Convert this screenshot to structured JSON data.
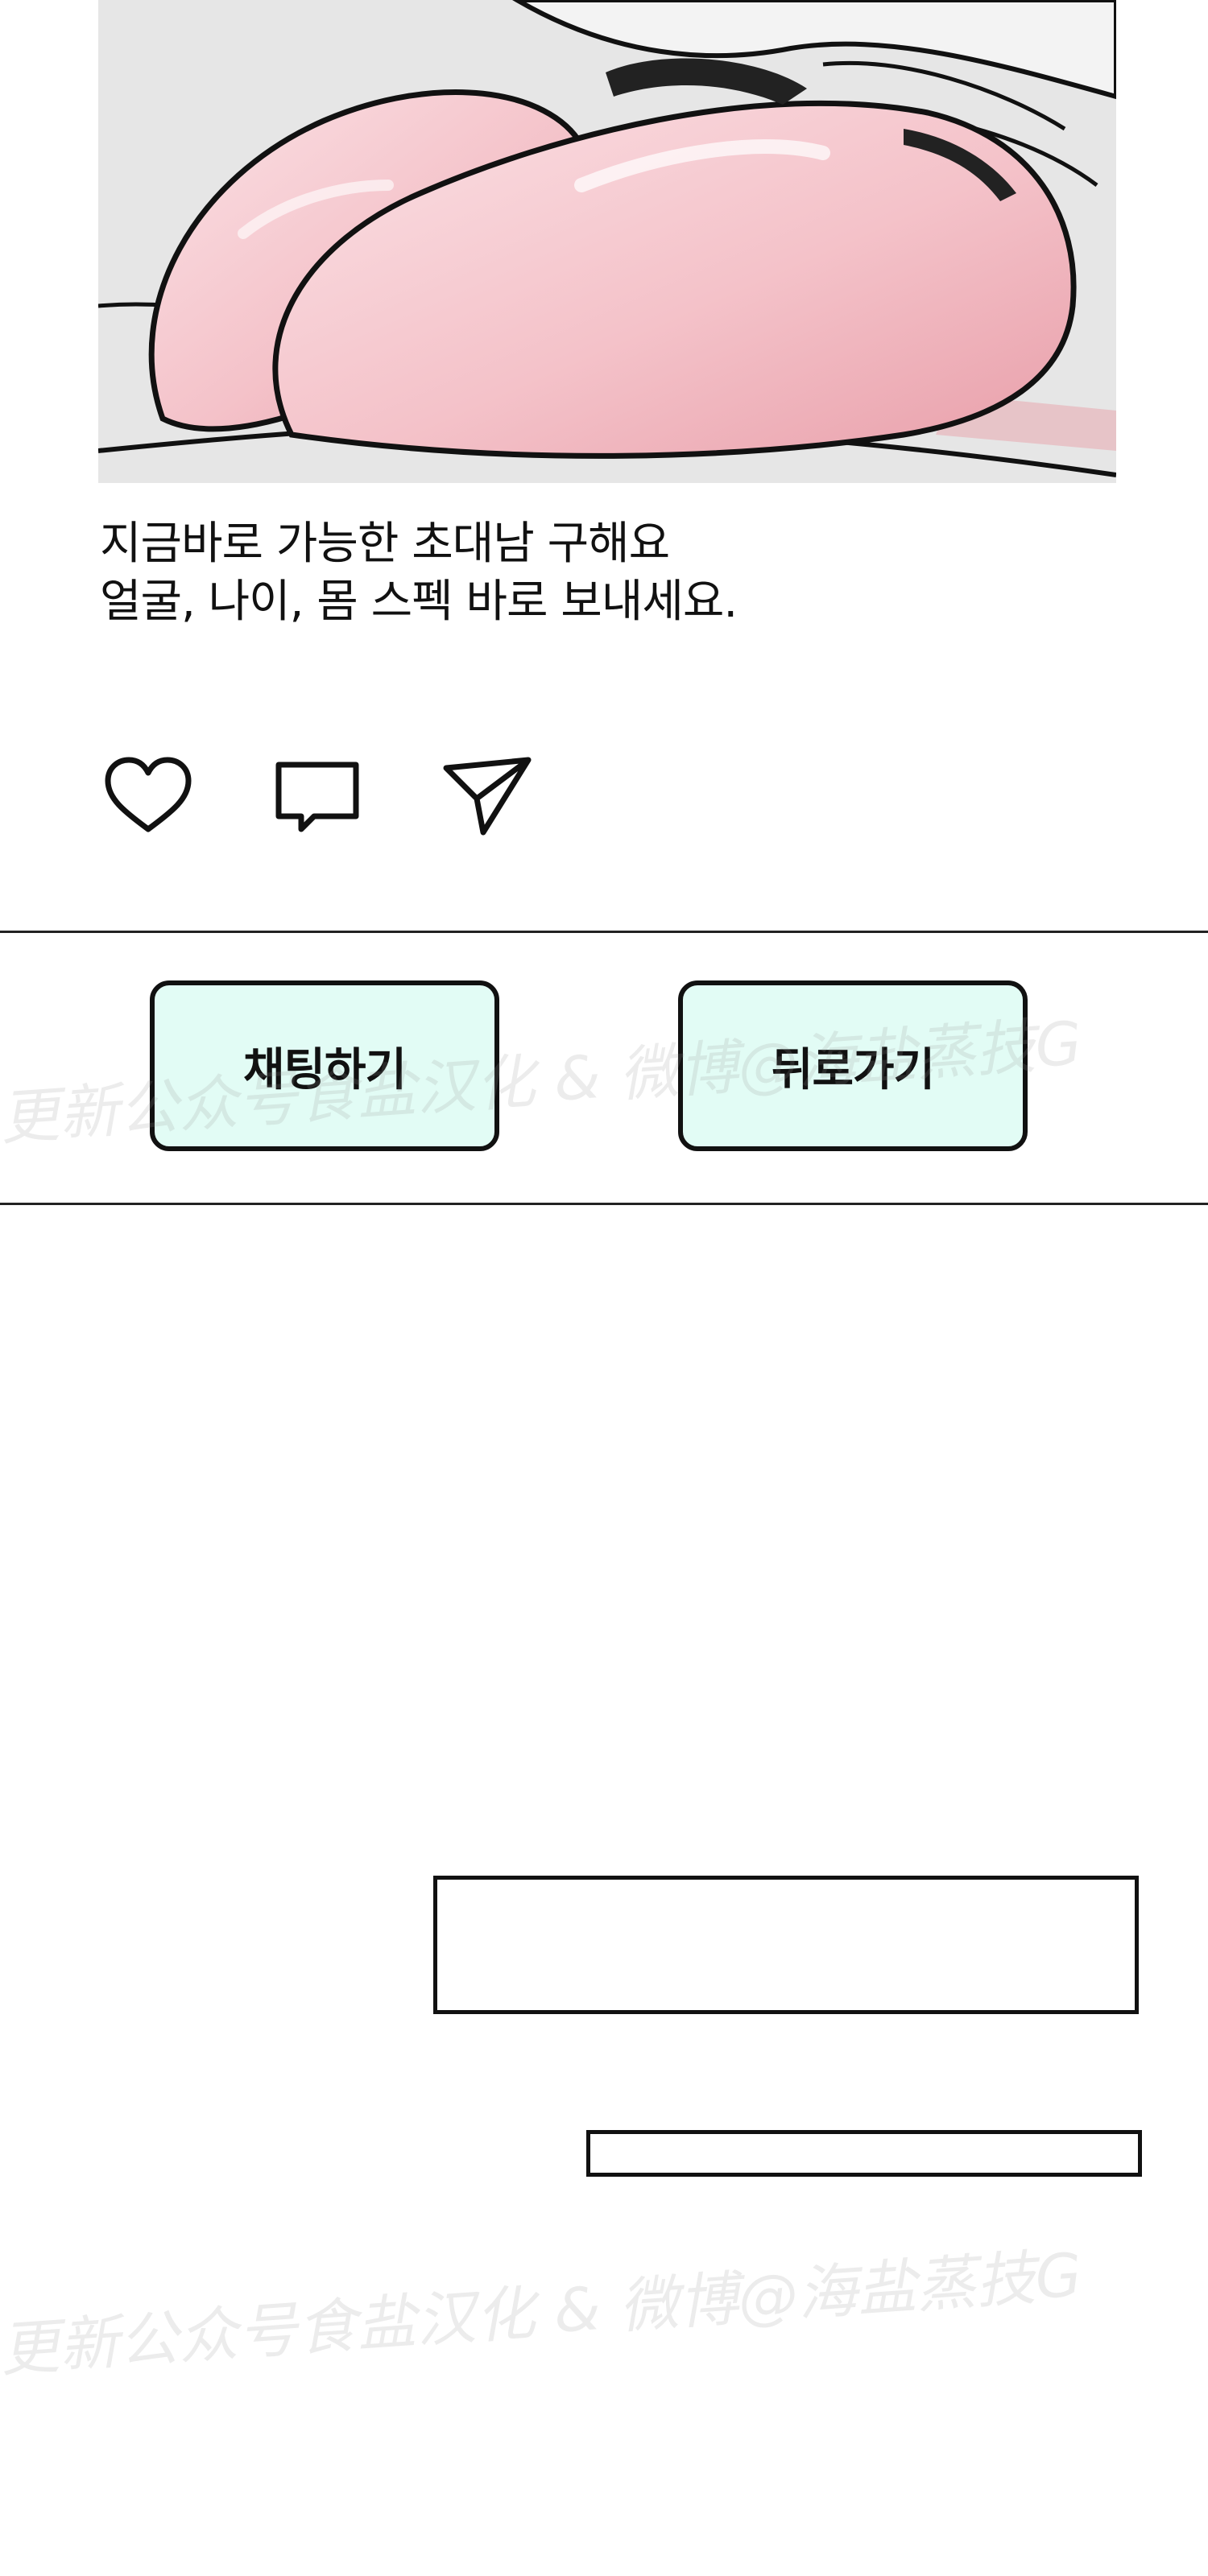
{
  "post": {
    "caption_lines": [
      "지금바로 가능한 초대남 구해요",
      "얼굴, 나이, 몸 스펙 바로 보내세요."
    ],
    "actions": {
      "like_icon": "heart-icon",
      "comment_icon": "comment-icon",
      "share_icon": "send-icon"
    }
  },
  "dialog": {
    "chat_label": "채팅하기",
    "back_label": "뒤로가기",
    "button_color": "#e2fcf5"
  },
  "watermark": {
    "text": "更新公众号食盐汉化 & 微博@海盐蒸技G"
  },
  "colors": {
    "skin": "#f2b9c0",
    "skin_highlight": "#fbe3e6",
    "background_gray": "#e6e6e6",
    "outline": "#111111"
  }
}
